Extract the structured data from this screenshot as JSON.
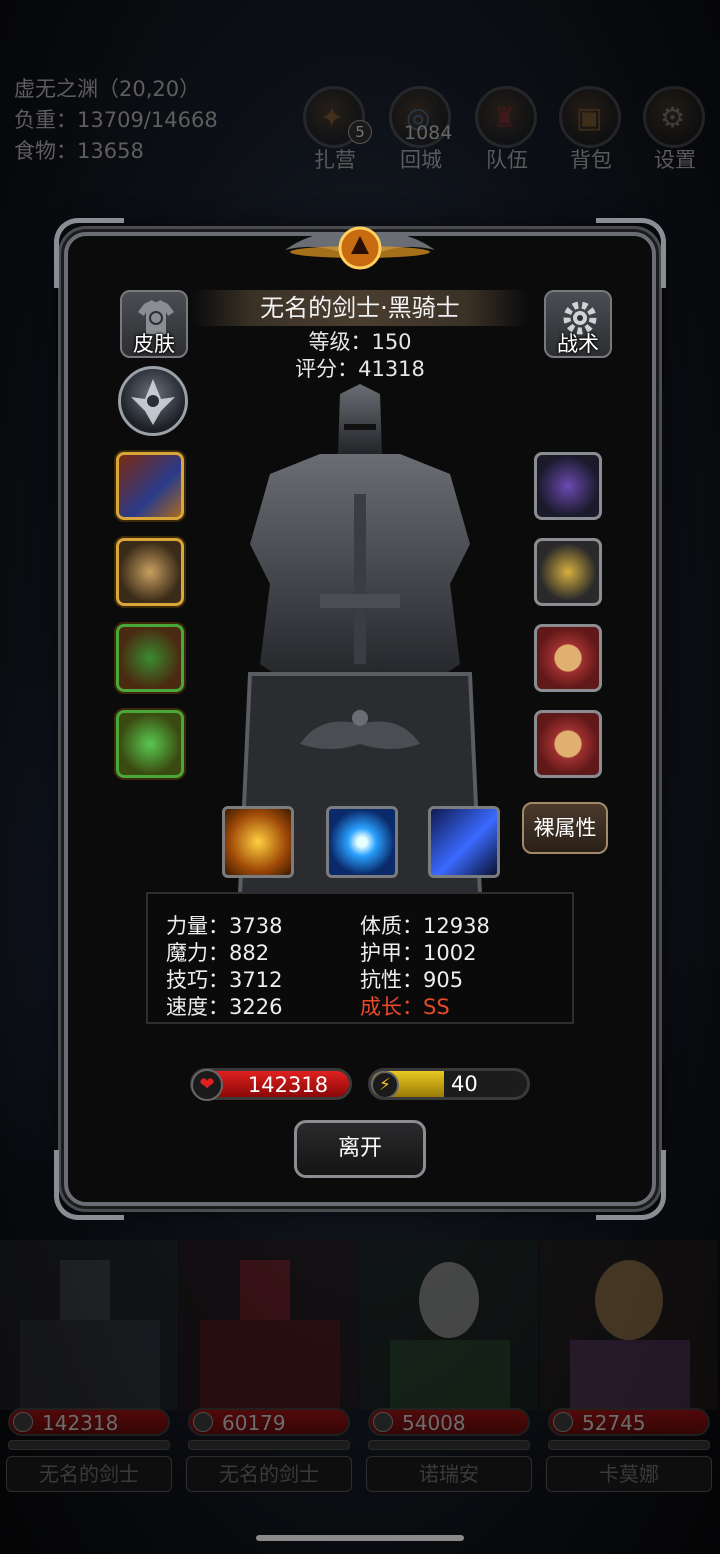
{
  "location": "虚无之渊（20,20）",
  "load": "负重：13709/14668",
  "food": "食物：13658",
  "top_buttons": [
    {
      "label": "扎营",
      "badge": "5",
      "icon": "camp-icon"
    },
    {
      "label": "回城",
      "count": "1084",
      "icon": "portal-icon"
    },
    {
      "label": "队伍",
      "icon": "team-icon"
    },
    {
      "label": "背包",
      "icon": "backpack-icon"
    },
    {
      "label": "设置",
      "icon": "gear-icon"
    }
  ],
  "character": {
    "name": "无名的剑士·黑骑士",
    "level": "等级：150",
    "score": "评分：41318",
    "skin_label": "皮肤",
    "tactics_label": "战术",
    "naked_stats_label": "裸属性"
  },
  "stats": {
    "strength": "力量：3738",
    "constitution": "体质：12938",
    "magic": "魔力：882",
    "armor": "护甲：1002",
    "skill": "技巧：3712",
    "resistance": "抗性：905",
    "speed": "速度：3226",
    "growth": "成长：SS"
  },
  "hp": "142318",
  "energy": {
    "value": "40",
    "fill_fraction": 0.47
  },
  "leave_label": "离开",
  "colors": {
    "growth": "#e8492a",
    "hp": "#e02020",
    "energy": "#e8c820",
    "frame": "#8a8d92"
  },
  "team": [
    {
      "hp": "142318",
      "name": "无名的剑士"
    },
    {
      "hp": "60179",
      "name": "无名的剑士"
    },
    {
      "hp": "54008",
      "name": "诺瑞安"
    },
    {
      "hp": "52745",
      "name": "卡莫娜"
    }
  ]
}
